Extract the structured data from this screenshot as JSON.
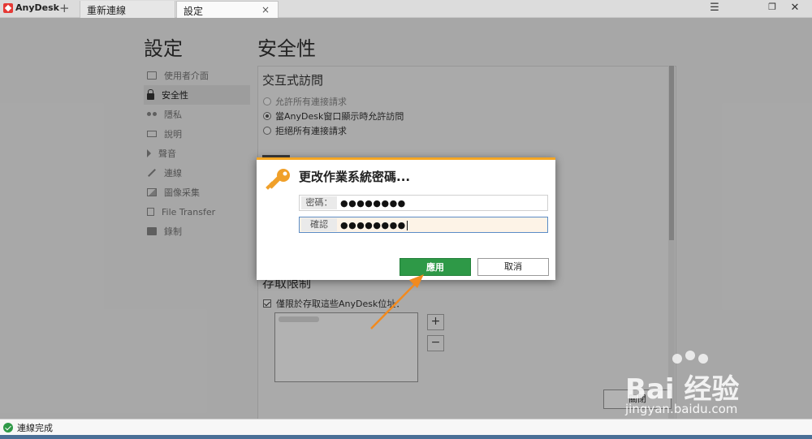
{
  "app": {
    "name": "AnyDesk",
    "new_tab_symbol": "+",
    "tabs": [
      {
        "label": "重新連線",
        "active": false
      },
      {
        "label": "設定",
        "active": true,
        "close": "×"
      }
    ],
    "window_controls": {
      "menu": "☰",
      "restore": "❐",
      "close": "✕"
    }
  },
  "settings": {
    "heading": "設定",
    "sidebar": [
      {
        "label": "使用者介面",
        "icon": "monitor-box-icon",
        "active": false
      },
      {
        "label": "安全性",
        "icon": "lock-icon",
        "active": true
      },
      {
        "label": "隱私",
        "icon": "glasses-icon",
        "active": false
      },
      {
        "label": "說明",
        "icon": "monitor-icon",
        "active": false
      },
      {
        "label": "聲音",
        "icon": "speaker-icon",
        "active": false
      },
      {
        "label": "連線",
        "icon": "plug-icon",
        "active": false
      },
      {
        "label": "圖像采集",
        "icon": "image-icon",
        "active": false
      },
      {
        "label": "File Transfer",
        "icon": "file-icon",
        "active": false
      },
      {
        "label": "錄制",
        "icon": "record-icon",
        "active": false
      }
    ]
  },
  "security": {
    "heading": "安全性",
    "interactive_access": {
      "title": "交互式訪問",
      "options": [
        {
          "label": "允許所有連接請求",
          "selected": false,
          "dim": true
        },
        {
          "label": "當AnyDesk窗口顯示時允許訪問",
          "selected": true,
          "dim": false
        },
        {
          "label": "拒絕所有連接請求",
          "selected": false,
          "dim": false
        }
      ]
    },
    "access_restriction": {
      "title": "存取限制",
      "checkbox_label": "僅限於存取這些AnyDesk位址：",
      "checked": true,
      "add_symbol": "+",
      "remove_symbol": "−"
    },
    "close_button": "關閉"
  },
  "dialog": {
    "title": "更改作業系統密碼...",
    "password_label": "密碼：",
    "password_value": "●●●●●●●●",
    "confirm_label": "確認",
    "confirm_value": "●●●●●●●●",
    "apply_button": "應用",
    "cancel_button": "取消",
    "accent_color": "#f5a623",
    "apply_color": "#2e9947"
  },
  "status": {
    "text": "連線完成",
    "icon": "check-circle-icon"
  },
  "watermark": {
    "brand": "Bai",
    "brand_suffix": "经验",
    "url": "jingyan.baidu.com"
  }
}
